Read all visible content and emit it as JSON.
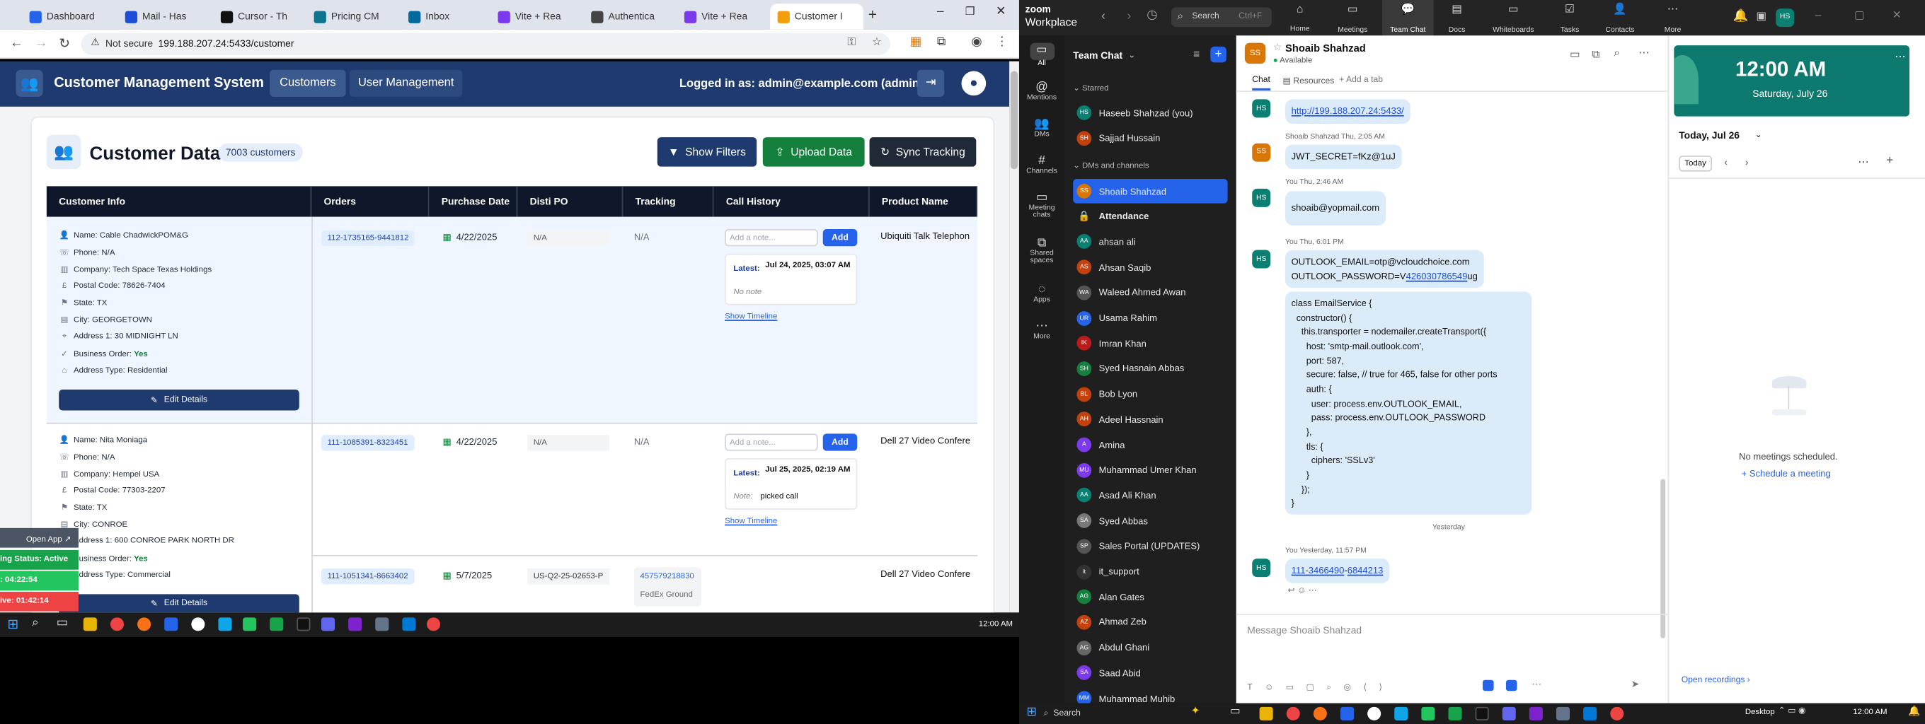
{
  "browser": {
    "tabs": [
      "Dashboard",
      "Mail - Has",
      "Cursor - Th",
      "Pricing CM",
      "Inbox",
      "Vite + Rea",
      "Authentica",
      "Vite + Rea",
      "Customer I"
    ],
    "not_secure": "Not secure",
    "url": "199.188.207.24:5433/customer"
  },
  "app": {
    "title": "Customer Management System",
    "nav_customers": "Customers",
    "nav_user_mgmt": "User Management",
    "logged_in": "Logged in as: admin@example.com (admin)",
    "page_title": "Customer Data",
    "count_badge": "7003 customers",
    "btn_filters": "Show Filters",
    "btn_upload": "Upload Data",
    "btn_sync": "Sync Tracking",
    "columns": [
      "Customer Info",
      "Orders",
      "Purchase Date",
      "Disti PO",
      "Tracking",
      "Call History",
      "Product Name"
    ],
    "labels": {
      "name": "Name:",
      "phone": "Phone:",
      "company": "Company:",
      "postal": "Postal Code:",
      "state": "State:",
      "city": "City:",
      "address": "Address 1:",
      "business": "Business Order:",
      "addrtype": "Address Type:"
    },
    "rows": [
      {
        "name": "Cable ChadwickPOM&G",
        "phone": "N/A",
        "company": "Tech Space Texas Holdings",
        "postal": "78626-7404",
        "state": "TX",
        "city": "GEORGETOWN",
        "address": "30 MIDNIGHT LN",
        "business": "Yes",
        "addrtype": "Residential",
        "order": "112-1735165-9441812",
        "date": "4/22/2025",
        "disti": "N/A",
        "tracking": "N/A",
        "note_ph": "Add a note...",
        "add": "Add",
        "latest": "Latest:",
        "latest_time": "Jul 24, 2025, 03:07 AM",
        "latest_note": "No note",
        "timeline": "Show Timeline",
        "product": "Ubiquiti Talk Telephon",
        "edit": "Edit Details"
      },
      {
        "name": "Nita Moniaga",
        "phone": "N/A",
        "company": "Hempel USA",
        "postal": "77303-2207",
        "state": "TX",
        "city": "CONROE",
        "address": "600 CONROE PARK NORTH DR",
        "business": "Yes",
        "addrtype": "Commercial",
        "order": "111-1085391-8323451",
        "date": "4/22/2025",
        "disti": "N/A",
        "tracking": "N/A",
        "note_ph": "Add a note...",
        "add": "Add",
        "latest": "Latest:",
        "latest_time": "Jul 25, 2025, 02:19 AM",
        "note_label": "Note:",
        "latest_note": "picked call",
        "timeline": "Show Timeline",
        "product": "Dell 27 Video Confere",
        "edit": "Edit Details"
      },
      {
        "order": "111-1051341-8663402",
        "date": "5/7/2025",
        "disti": "US-Q2-25-02653-P",
        "tracking": "457579218830",
        "carrier": "FedEx Ground",
        "product": "Dell 27 Video Confere"
      }
    ],
    "overlay": {
      "open_app": "Open App",
      "status": "ing Status: Active",
      "t1": ": 04:22:54",
      "t2": "ive: 01:42:14"
    }
  },
  "taskbar_left": {
    "time": "12:00 AM"
  },
  "zoom": {
    "brand_top": "zoom",
    "brand_bottom": "Workplace",
    "search": "Search",
    "shortcut": "Ctrl+F",
    "nav": [
      "Home",
      "Meetings",
      "Team Chat",
      "Docs",
      "Whiteboards",
      "Tasks",
      "Contacts",
      "More"
    ],
    "user_initials": "HS",
    "rail": [
      "All",
      "Mentions",
      "DMs",
      "Channels",
      "Meeting chats",
      "Shared spaces",
      "Apps",
      "More"
    ],
    "list_title": "Team Chat",
    "starred": "Starred",
    "dms_channels": "DMs and channels",
    "starred_items": [
      {
        "i": "HS",
        "n": "Haseeb Shahzad (you)",
        "c": "#0a7f72"
      },
      {
        "i": "SH",
        "n": "Sajjad Hussain",
        "c": "#c2410c"
      }
    ],
    "contacts": [
      {
        "i": "SS",
        "n": "Shoaib Shahzad",
        "c": "#d97706"
      },
      {
        "i": "#",
        "n": "Attendance",
        "c": ""
      },
      {
        "i": "AA",
        "n": "ahsan ali",
        "c": "#0a7f72"
      },
      {
        "i": "AS",
        "n": "Ahsan Saqib",
        "c": "#c2410c"
      },
      {
        "i": "WA",
        "n": "Waleed Ahmed Awan",
        "c": "#555"
      },
      {
        "i": "UR",
        "n": "Usama Rahim",
        "c": "#2563eb"
      },
      {
        "i": "IK",
        "n": "Imran Khan",
        "c": "#b91c1c"
      },
      {
        "i": "SH",
        "n": "Syed Hasnain Abbas",
        "c": "#15803d"
      },
      {
        "i": "BL",
        "n": "Bob Lyon",
        "c": "#c2410c"
      },
      {
        "i": "AH",
        "n": "Adeel Hassnain",
        "c": "#c2410c"
      },
      {
        "i": "A",
        "n": "Amina",
        "c": "#7c3aed"
      },
      {
        "i": "MU",
        "n": "Muhammad Umer Khan",
        "c": "#7c3aed"
      },
      {
        "i": "AA",
        "n": "Asad Ali Khan",
        "c": "#0a7f72"
      },
      {
        "i": "SA",
        "n": "Syed Abbas",
        "c": "#777"
      },
      {
        "i": "SP",
        "n": "Sales Portal (UPDATES)",
        "c": "#555"
      },
      {
        "i": "it",
        "n": "it_support",
        "c": "#333"
      },
      {
        "i": "AG",
        "n": "Alan Gates",
        "c": "#15803d"
      },
      {
        "i": "AZ",
        "n": "Ahmad Zeb",
        "c": "#c2410c"
      },
      {
        "i": "AG",
        "n": "Abdul Ghani",
        "c": "#666"
      },
      {
        "i": "SA",
        "n": "Saad Abid",
        "c": "#7c3aed"
      },
      {
        "i": "MM",
        "n": "Muhammad Muhib",
        "c": "#2563eb"
      }
    ],
    "chat": {
      "name": "Shoaib Shahzad",
      "status": "Available",
      "tab_chat": "Chat",
      "tab_res": "Resources",
      "tab_add": "Add a tab",
      "m1_link": "http://199.188.207.24:5433/",
      "m2_meta": "Shoaib Shahzad  Thu, 2:05 AM",
      "m2": "JWT_SECRET=fKz@1uJ",
      "m3_meta": "You  Thu, 2:46 AM",
      "m3": "shoaib@yopmail.com",
      "m4_meta": "You  Thu, 6:01 PM",
      "m4a": "OUTLOOK_EMAIL=otp@vcloudchoice.com",
      "m4b_pre": "OUTLOOK_PASSWORD=V",
      "m4b_link": "426030786549",
      "m4b_post": "ug",
      "code": "class EmailService {\n  constructor() {\n    this.transporter = nodemailer.createTransport({\n      host: 'smtp-mail.outlook.com',\n      port: 587,\n      secure: false, // true for 465, false for other ports\n      auth: {\n        user: process.env.OUTLOOK_EMAIL,\n        pass: process.env.OUTLOOK_PASSWORD\n      },\n      tls: {\n        ciphers: 'SSLv3'\n      }\n    });\n}",
      "divider": "Yesterday",
      "m5_meta": "You  Yesterday, 11:57 PM",
      "m5a": "111-3466490",
      "m5sep": "-",
      "m5b": "6844213",
      "composer": "Message Shoaib Shahzad"
    },
    "calendar": {
      "time": "12:00 AM",
      "date": "Saturday, July 26",
      "today_label": "Today, Jul 26",
      "today_btn": "Today",
      "empty": "No meetings scheduled.",
      "schedule": "Schedule a meeting",
      "recordings": "Open recordings"
    }
  },
  "taskbar_right": {
    "search": "Search",
    "desktop": "Desktop",
    "time": "12:00 AM"
  }
}
